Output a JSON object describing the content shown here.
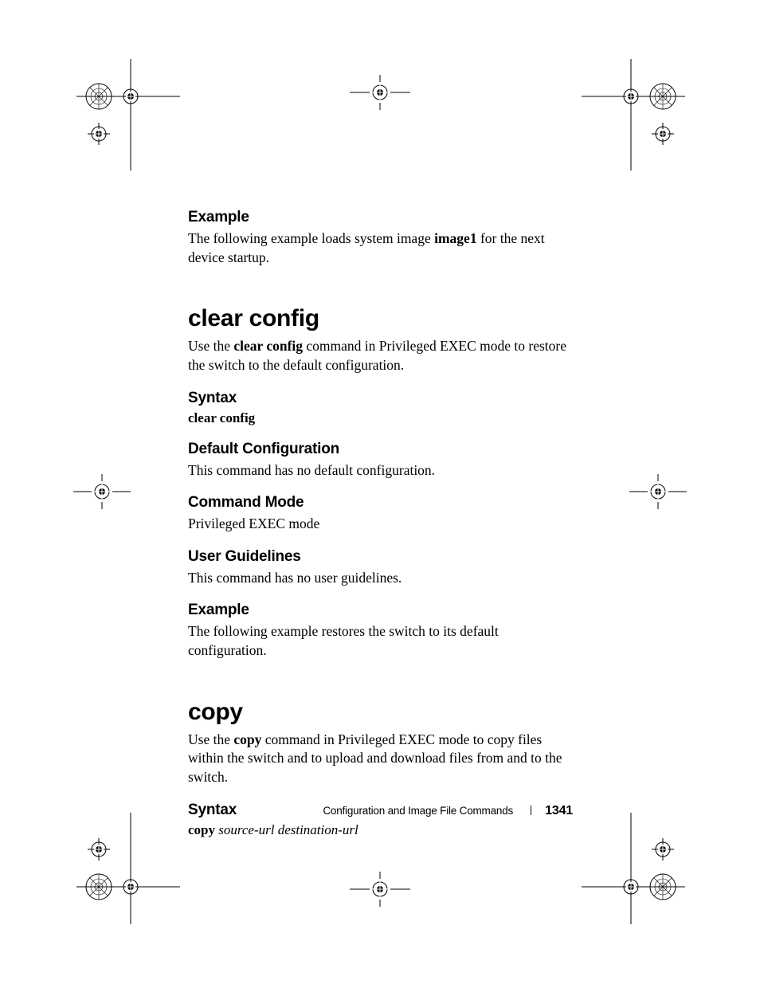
{
  "section1": {
    "example_heading": "Example",
    "example_text_pre": "The following example loads system image ",
    "example_bold": "image1",
    "example_text_post": " for the next device startup."
  },
  "clear_config": {
    "title": "clear config",
    "intro_pre": "Use the ",
    "intro_cmd": "clear config",
    "intro_post": " command in Privileged EXEC mode to restore the switch to the default configuration.",
    "syntax_heading": "Syntax",
    "syntax_line": "clear config",
    "default_heading": "Default Configuration",
    "default_text": "This command has no default configuration.",
    "mode_heading": "Command Mode",
    "mode_text": "Privileged EXEC mode",
    "guidelines_heading": "User Guidelines",
    "guidelines_text": "This command has no user guidelines.",
    "example_heading": "Example",
    "example_text": "The following example restores the switch to its default configuration."
  },
  "copy": {
    "title": "copy",
    "intro_pre": "Use the ",
    "intro_cmd": "copy",
    "intro_post": " command in Privileged EXEC mode to copy files within the switch and to upload and download files from and to the switch.",
    "syntax_heading": "Syntax",
    "syntax_cmd": "copy",
    "syntax_args": "source-url destination-url"
  },
  "footer": {
    "chapter": "Configuration and Image File Commands",
    "page": "1341"
  }
}
